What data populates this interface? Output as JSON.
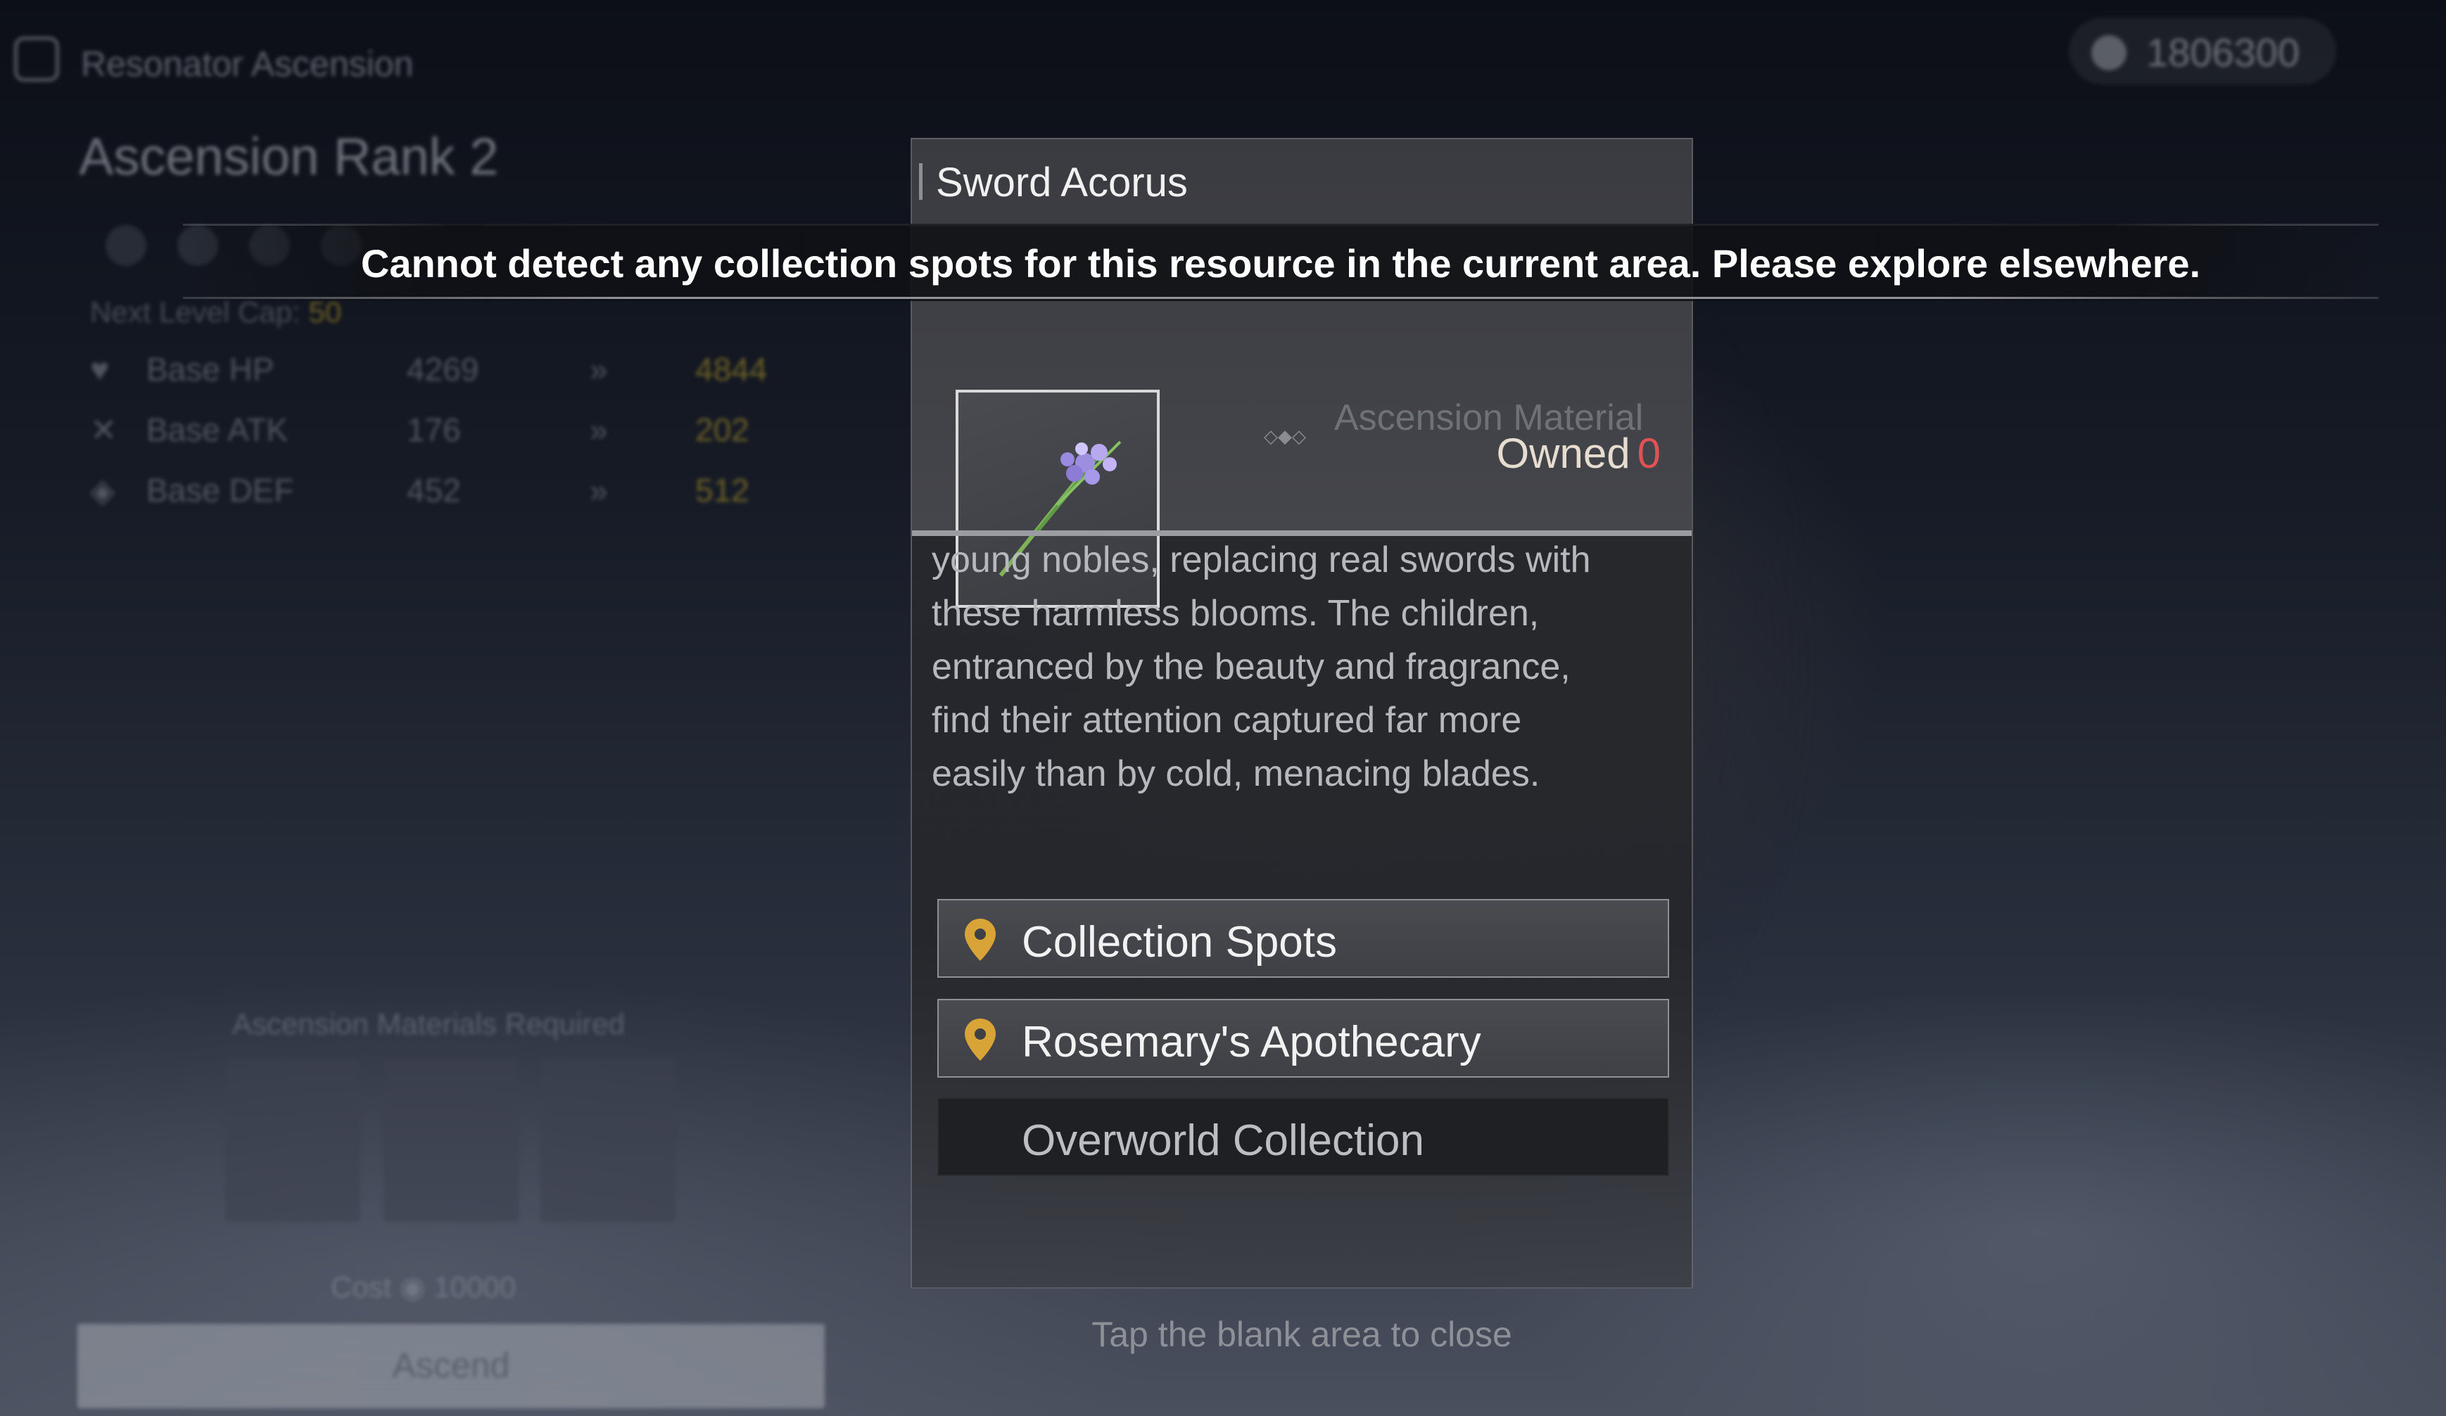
{
  "background": {
    "screen_title": "Resonator Ascension",
    "rank_title": "Ascension Rank 2",
    "next_level_cap_label": "Next Level Cap:",
    "next_level_cap_value": "50",
    "stats": [
      {
        "name": "Base HP",
        "current": "4269",
        "next": "4844"
      },
      {
        "name": "Base ATK",
        "current": "176",
        "next": "202"
      },
      {
        "name": "Base DEF",
        "current": "452",
        "next": "512"
      }
    ],
    "materials_title": "Ascension Materials Required",
    "cost_label": "Cost",
    "cost_value": "10000",
    "ascend_label": "Ascend",
    "currency_value": "1806300"
  },
  "popup": {
    "item_name": "Sword Acorus",
    "item_type": "Ascension Material",
    "owned_label": "Owned",
    "owned_count": "0",
    "description": "young nobles, replacing real swords with\nthese harmless blooms. The children,\nentranced by the beauty and fragrance,\nfind their attention captured far more\neasily than by cold, menacing blades.",
    "sources": [
      {
        "label": "Collection Spots",
        "icon": "location-pin-icon",
        "active": true
      },
      {
        "label": "Rosemary's Apothecary",
        "icon": "location-pin-icon",
        "active": true
      },
      {
        "label": "Overworld Collection",
        "icon": "",
        "active": false
      }
    ],
    "close_hint": "Tap the blank area to close"
  },
  "toast": {
    "message": "Cannot detect any collection spots for this resource in the current area. Please explore elsewhere."
  },
  "colors": {
    "owned_zero": "#e15252",
    "pin": "#d9a437",
    "stat_highlight": "#b59a2a"
  }
}
